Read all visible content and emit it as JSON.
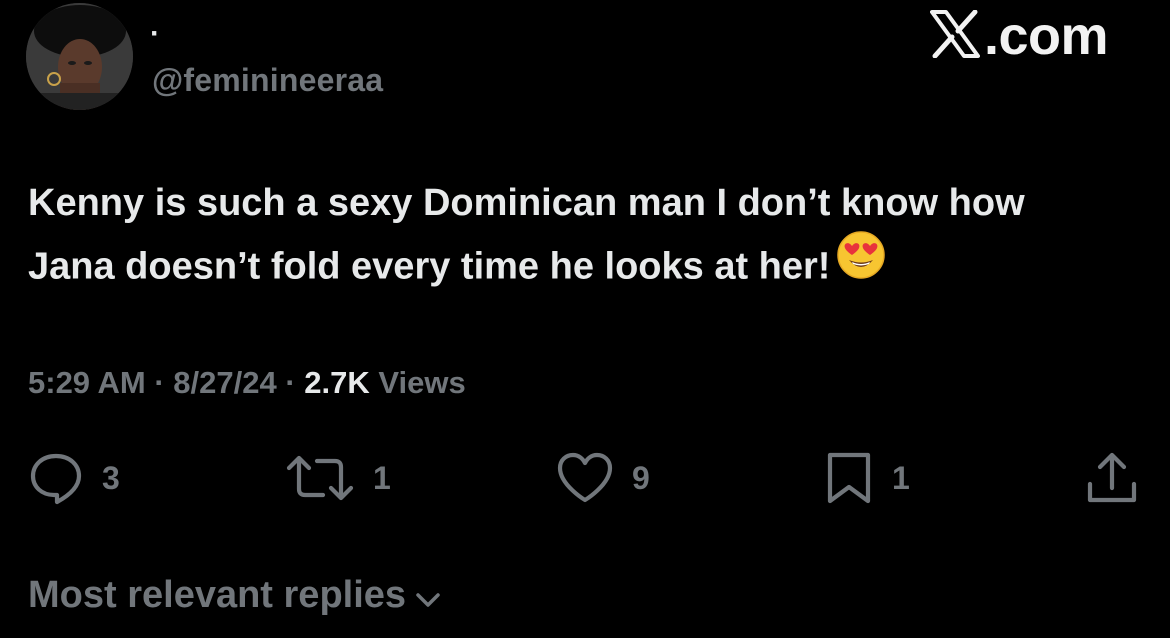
{
  "author": {
    "display_name": "·",
    "handle": "@feminineeraa",
    "avatar_icon": "profile-photo"
  },
  "watermark": {
    "text": ".com",
    "logo_icon": "x-logo-icon"
  },
  "tweet": {
    "line1": "Kenny is such a sexy Dominican man I don’t know how",
    "line2": "Jana doesn’t fold every time he looks at her!",
    "emoji_icon": "heart-eyes-emoji-icon"
  },
  "meta": {
    "time": "5:29 AM",
    "sep1": " · ",
    "date": "8/27/24",
    "sep2": " · ",
    "views_count": "2.7K",
    "views_label": " Views"
  },
  "actions": {
    "replies": "3",
    "reposts": "1",
    "likes": "9",
    "bookmarks": "1"
  },
  "replies_sort": {
    "label": "Most relevant replies"
  },
  "colors": {
    "background": "#000000",
    "primary_text": "#e7e9ea",
    "secondary_text": "#71767b"
  }
}
